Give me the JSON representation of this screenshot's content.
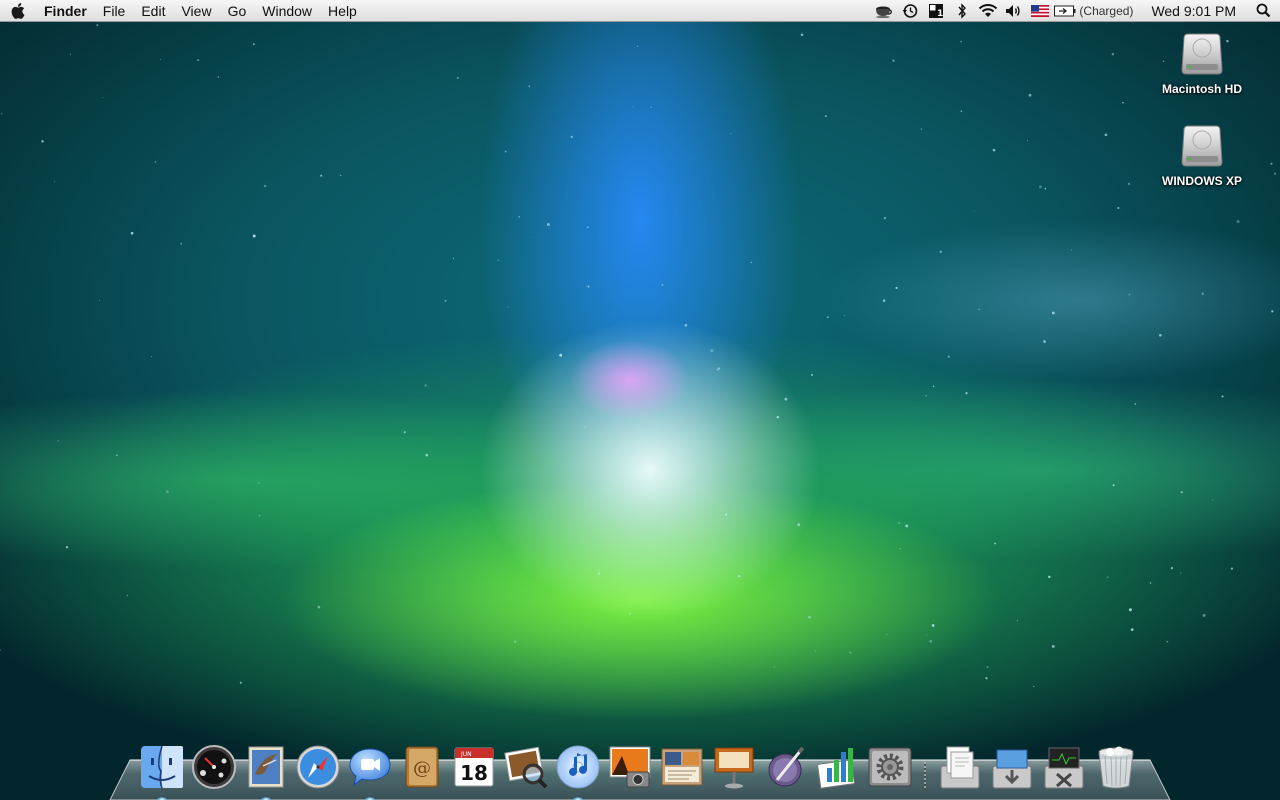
{
  "menubar": {
    "app_name": "Finder",
    "menus": [
      "File",
      "Edit",
      "View",
      "Go",
      "Window",
      "Help"
    ],
    "status_icons": [
      "coffee-cup-icon",
      "time-machine-icon",
      "spaces-icon",
      "bluetooth-icon",
      "wifi-icon",
      "volume-icon",
      "us-flag-input-icon",
      "battery-icon"
    ],
    "battery_status": "(Charged)",
    "clock": "Wed 9:01 PM",
    "spotlight": "spotlight-search-icon"
  },
  "desktop": {
    "icons": [
      {
        "label": "Macintosh HD",
        "icon": "hard-drive-icon"
      },
      {
        "label": "WINDOWS XP",
        "icon": "hard-drive-icon"
      }
    ]
  },
  "dock": {
    "apps": [
      {
        "icon": "finder-icon",
        "running": true
      },
      {
        "icon": "dashboard-icon",
        "running": false
      },
      {
        "icon": "mail-icon",
        "running": true
      },
      {
        "icon": "safari-icon",
        "running": false
      },
      {
        "icon": "ichat-icon",
        "running": true
      },
      {
        "icon": "address-book-icon",
        "running": false
      },
      {
        "icon": "ical-icon",
        "running": false,
        "month": "JUN",
        "day": "18"
      },
      {
        "icon": "preview-icon",
        "running": false
      },
      {
        "icon": "itunes-icon",
        "running": true
      },
      {
        "icon": "iphoto-icon",
        "running": false
      },
      {
        "icon": "iwork-pages-icon",
        "running": false
      },
      {
        "icon": "keynote-icon",
        "running": false
      },
      {
        "icon": "script-editor-icon",
        "running": false
      },
      {
        "icon": "numbers-icon",
        "running": false
      },
      {
        "icon": "system-preferences-icon",
        "running": false
      }
    ],
    "stacks": [
      {
        "icon": "documents-stack-icon"
      },
      {
        "icon": "downloads-stack-icon"
      },
      {
        "icon": "utilities-stack-icon"
      },
      {
        "icon": "trash-icon"
      }
    ]
  }
}
